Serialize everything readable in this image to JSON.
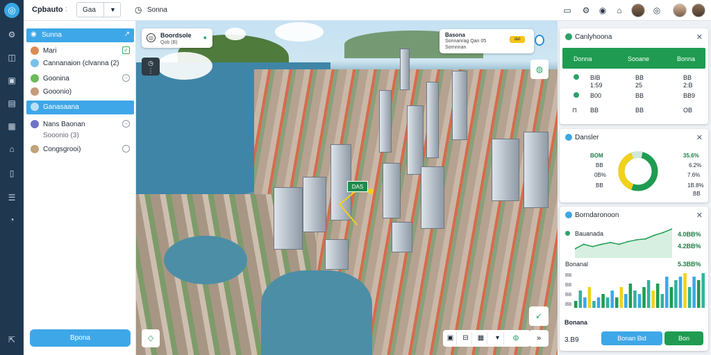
{
  "colors": {
    "accent": "#3ea7e8",
    "green": "#1f9c51",
    "rail": "#1f3850",
    "yellow": "#f3d11a"
  },
  "header": {
    "title": "Cpbauto",
    "separator": ":",
    "tab_select_value": "Gaa",
    "scene_label": "Sonna"
  },
  "rail": {
    "icons": [
      "logo-icon",
      "settings-icon",
      "layers-icon",
      "inbox-icon",
      "chart-icon",
      "calendar-icon",
      "home-icon",
      "document-icon",
      "checklist-icon",
      "help-icon",
      "export-icon"
    ]
  },
  "layers": {
    "header_label": "Sunna",
    "items": [
      {
        "label": "Mari",
        "checked": true
      },
      {
        "label": "Cannanaion (clvanna (2)",
        "checked": false
      },
      {
        "label": "Goonina",
        "checked": false
      },
      {
        "label": "Gooonio)",
        "checked": false
      },
      {
        "label": "Ganasaana",
        "checked": false,
        "active": true
      },
      {
        "label": "Nans Baonan",
        "sub": "Sooonio (3)",
        "checked": false
      },
      {
        "label": "Congsgrooi)",
        "checked": false
      }
    ],
    "apply_label": "Bpona"
  },
  "map": {
    "info_card": {
      "title": "Boordsole",
      "subtitle": "Qob (B)"
    },
    "alert_card": {
      "title": "Basona",
      "line1": "Sonnanrag Qan 05",
      "line2": "Sornnnan",
      "badge": "dat"
    },
    "label": "DAS"
  },
  "stats_panel": {
    "title": "Canlyhoona",
    "columns": [
      "Donna",
      "Sooane",
      "Bonna"
    ],
    "rows": [
      {
        "a": "BIB",
        "b": "BB",
        "c": "BB"
      },
      {
        "a": "1:59",
        "b": "25",
        "c": "2:B"
      },
      {
        "a": "B00",
        "b": "BB",
        "c": "BB9"
      },
      {
        "a": "BB",
        "b": "BB",
        "c": "OB"
      }
    ]
  },
  "donut_panel": {
    "title": "Dansler",
    "left_labels": [
      "BOM",
      "BB",
      "0B%",
      "BB"
    ],
    "right_labels": [
      "35.6%",
      "6.2%",
      "7.6%",
      "1B.8%",
      "BB"
    ]
  },
  "trend_panel": {
    "title": "Borndaronoon",
    "series_a_label": "Bauanada",
    "value_1": "4.0BB%",
    "value_2": "4.2BB%",
    "series_b_label": "Bonanal",
    "value_3": "5.3BB%",
    "y_ticks": [
      "BB",
      "BB",
      "BB",
      "BB"
    ],
    "footer_label": "Bonana",
    "footer_value": "3.B9",
    "button_primary": "Bonan Bid",
    "button_secondary": "Bon"
  },
  "chart_data": {
    "type": "line",
    "title": "",
    "line_series": [
      {
        "name": "Bauanada",
        "values": [
          2,
          3,
          2.5,
          3,
          3.4,
          3,
          3.6,
          4,
          4.2,
          5,
          5.6,
          6.4
        ]
      }
    ],
    "bar_series": [
      {
        "name": "Bonanal",
        "values": [
          2,
          5,
          3,
          6,
          2,
          3,
          4,
          3,
          5,
          3,
          6,
          4,
          7,
          5,
          4,
          6,
          8,
          5,
          7,
          4,
          9,
          6,
          8,
          9,
          10,
          6,
          9,
          8,
          10
        ]
      }
    ],
    "grid": false
  }
}
